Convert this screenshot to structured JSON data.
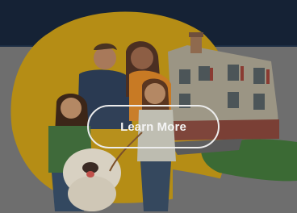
{
  "hero": {
    "cta_label": "Learn More",
    "illustration_icon": "family-with-dog-in-front-of-house",
    "colors": {
      "header_bg": "#152235",
      "page_bg": "#6e6e6e",
      "sun_yellow": "#c89a18",
      "house_wall": "#a09a88",
      "lawn_green": "#3e6a36"
    }
  }
}
